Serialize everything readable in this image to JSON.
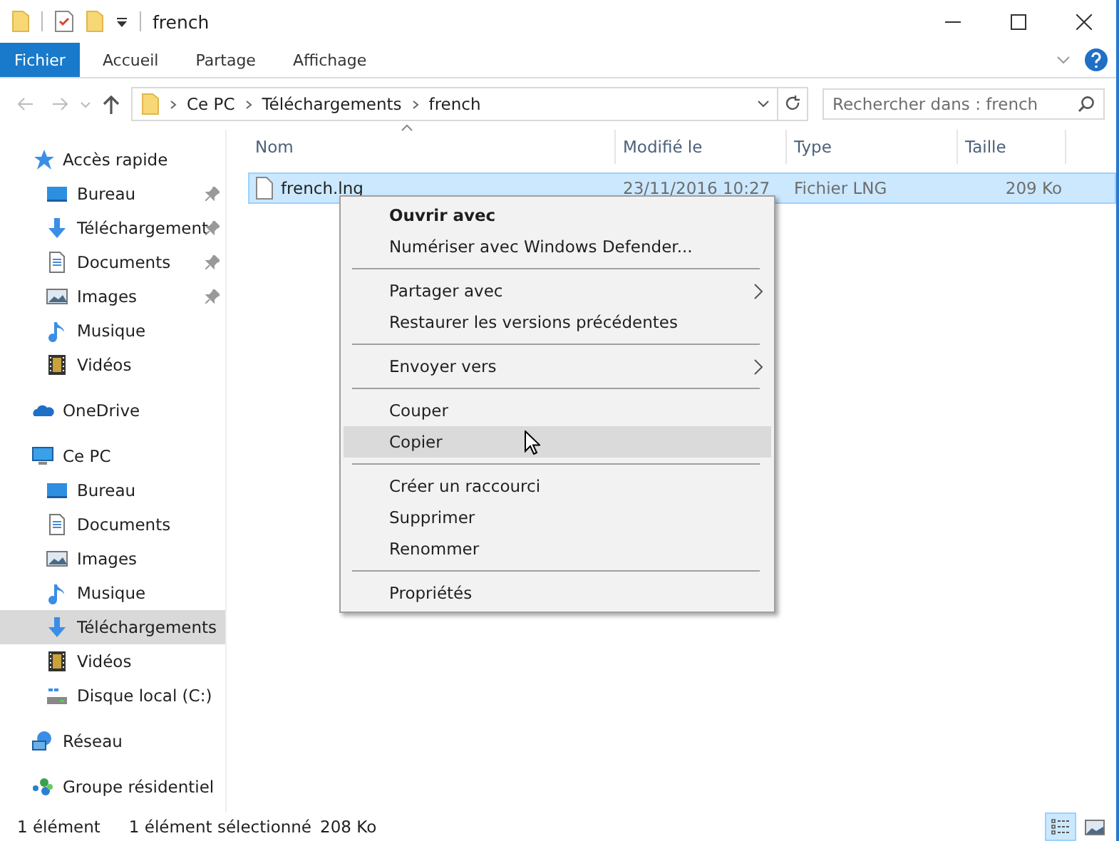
{
  "window": {
    "title": "french"
  },
  "ribbon": {
    "tabs": [
      {
        "label": "Fichier",
        "selected": true
      },
      {
        "label": "Accueil",
        "selected": false
      },
      {
        "label": "Partage",
        "selected": false
      },
      {
        "label": "Affichage",
        "selected": false
      }
    ]
  },
  "address": {
    "crumbs": [
      "Ce PC",
      "Téléchargements",
      "french"
    ],
    "search": {
      "placeholder": "Rechercher dans : french"
    }
  },
  "sidebar": {
    "groups": [
      {
        "label": "Accès rapide",
        "kind": "star",
        "children": [
          {
            "label": "Bureau",
            "kind": "desktop",
            "pinned": true,
            "selected": false
          },
          {
            "label": "Téléchargement",
            "kind": "download",
            "pinned": true,
            "selected": false
          },
          {
            "label": "Documents",
            "kind": "document",
            "pinned": true,
            "selected": false
          },
          {
            "label": "Images",
            "kind": "image",
            "pinned": true,
            "selected": false
          },
          {
            "label": "Musique",
            "kind": "music",
            "pinned": false,
            "selected": false
          },
          {
            "label": "Vidéos",
            "kind": "video",
            "pinned": false,
            "selected": false
          }
        ]
      },
      {
        "label": "OneDrive",
        "kind": "cloud"
      },
      {
        "label": "Ce PC",
        "kind": "pc",
        "children": [
          {
            "label": "Bureau",
            "kind": "desktop",
            "pinned": false,
            "selected": false
          },
          {
            "label": "Documents",
            "kind": "document",
            "pinned": false,
            "selected": false
          },
          {
            "label": "Images",
            "kind": "image",
            "pinned": false,
            "selected": false
          },
          {
            "label": "Musique",
            "kind": "music",
            "pinned": false,
            "selected": false
          },
          {
            "label": "Téléchargements",
            "kind": "download",
            "pinned": false,
            "selected": true
          },
          {
            "label": "Vidéos",
            "kind": "video",
            "pinned": false,
            "selected": false
          },
          {
            "label": "Disque local (C:)",
            "kind": "drive",
            "pinned": false,
            "selected": false
          }
        ]
      },
      {
        "label": "Réseau",
        "kind": "network"
      },
      {
        "label": "Groupe résidentiel",
        "kind": "homegroup"
      }
    ]
  },
  "table": {
    "columns": [
      "Nom",
      "Modifié le",
      "Type",
      "Taille"
    ],
    "rows": [
      {
        "name": "french.lng",
        "modified": "23/11/2016 10:27",
        "type": "Fichier LNG",
        "size": "209 Ko",
        "selected": true
      }
    ]
  },
  "context_menu": {
    "groups": [
      [
        {
          "label": "Ouvrir avec",
          "default": true,
          "submenu": false,
          "selected": false
        },
        {
          "label": "Numériser avec Windows Defender...",
          "default": false,
          "submenu": false,
          "selected": false
        }
      ],
      [
        {
          "label": "Partager avec",
          "default": false,
          "submenu": true,
          "selected": false
        },
        {
          "label": "Restaurer les versions précédentes",
          "default": false,
          "submenu": false,
          "selected": false
        }
      ],
      [
        {
          "label": "Envoyer vers",
          "default": false,
          "submenu": true,
          "selected": false
        }
      ],
      [
        {
          "label": "Couper",
          "default": false,
          "submenu": false,
          "selected": false
        },
        {
          "label": "Copier",
          "default": false,
          "submenu": false,
          "selected": true
        }
      ],
      [
        {
          "label": "Créer un raccourci",
          "default": false,
          "submenu": false,
          "selected": false
        },
        {
          "label": "Supprimer",
          "default": false,
          "submenu": false,
          "selected": false
        },
        {
          "label": "Renommer",
          "default": false,
          "submenu": false,
          "selected": false
        }
      ],
      [
        {
          "label": "Propriétés",
          "default": false,
          "submenu": false,
          "selected": false
        }
      ]
    ]
  },
  "status_bar": {
    "count": "1 élément",
    "selection": "1 élément sélectionné",
    "size": "208 Ko",
    "views": [
      {
        "kind": "details",
        "selected": true
      },
      {
        "kind": "thumbnails",
        "selected": false
      }
    ]
  }
}
